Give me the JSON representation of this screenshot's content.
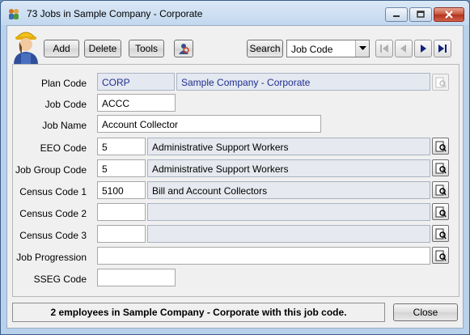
{
  "window": {
    "title": "73 Jobs in Sample Company - Corporate"
  },
  "toolbar": {
    "add_label": "Add",
    "delete_label": "Delete",
    "tools_label": "Tools",
    "search_label": "Search",
    "search_field_value": "Job Code"
  },
  "form": {
    "plan_code": {
      "label": "Plan Code",
      "code": "CORP",
      "description": "Sample Company - Corporate"
    },
    "job_code": {
      "label": "Job Code",
      "value": "ACCC"
    },
    "job_name": {
      "label": "Job Name",
      "value": "Account Collector"
    },
    "eeo_code": {
      "label": "EEO Code",
      "value": "5",
      "description": "Administrative Support Workers"
    },
    "job_group_code": {
      "label": "Job Group Code",
      "value": "5",
      "description": "Administrative Support Workers"
    },
    "census_code_1": {
      "label": "Census Code 1",
      "value": "5100",
      "description": "Bill and Account Collectors"
    },
    "census_code_2": {
      "label": "Census Code 2",
      "value": "",
      "description": ""
    },
    "census_code_3": {
      "label": "Census Code 3",
      "value": "",
      "description": ""
    },
    "job_progression": {
      "label": "Job Progression",
      "value": ""
    },
    "sseg_code": {
      "label": "SSEG Code",
      "value": ""
    }
  },
  "status": {
    "message": "2 employees in Sample Company - Corporate with this job code."
  },
  "footer": {
    "close_label": "Close"
  },
  "colors": {
    "accent": "#1f2f8f",
    "title_gradient_top": "#dbe8f6",
    "close_red": "#c75037"
  }
}
